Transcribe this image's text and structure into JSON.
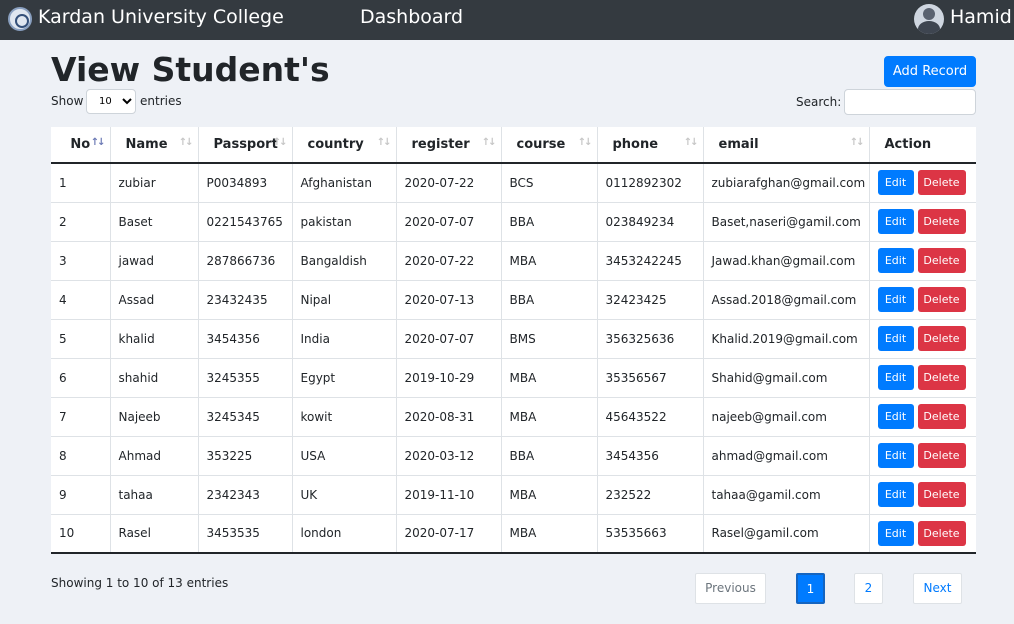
{
  "navbar": {
    "brand": "Kardan University College",
    "dashboard": "Dashboard",
    "user": "Hamid"
  },
  "page": {
    "title": "View Student's",
    "add_button": "Add Record"
  },
  "length": {
    "show": "Show",
    "value": "10",
    "entries": "entries"
  },
  "search": {
    "label": "Search:",
    "value": ""
  },
  "table": {
    "headers": [
      "No",
      "Name",
      "Passport",
      "country",
      "register",
      "course",
      "phone",
      "email",
      "Action"
    ],
    "rows": [
      [
        "1",
        "zubiar",
        "P0034893",
        "Afghanistan",
        "2020-07-22",
        "BCS",
        "0112892302",
        "zubiarafghan@gmail.com"
      ],
      [
        "2",
        "Baset",
        "0221543765",
        "pakistan",
        "2020-07-07",
        "BBA",
        "023849234",
        "Baset,naseri@gamil.com"
      ],
      [
        "3",
        "jawad",
        "287866736",
        "Bangaldish",
        "2020-07-22",
        "MBA",
        "3453242245",
        "Jawad.khan@gmail.com"
      ],
      [
        "4",
        "Assad",
        "23432435",
        "Nipal",
        "2020-07-13",
        "BBA",
        "32423425",
        "Assad.2018@gmail.com"
      ],
      [
        "5",
        "khalid",
        "3454356",
        "India",
        "2020-07-07",
        "BMS",
        "356325636",
        "Khalid.2019@gmail.com"
      ],
      [
        "6",
        "shahid",
        "3245355",
        "Egypt",
        "2019-10-29",
        "MBA",
        "35356567",
        "Shahid@gmail.com"
      ],
      [
        "7",
        "Najeeb",
        "3245345",
        "kowit",
        "2020-08-31",
        "MBA",
        "45643522",
        "najeeb@gmail.com"
      ],
      [
        "8",
        "Ahmad",
        "353225",
        "USA",
        "2020-03-12",
        "BBA",
        "3454356",
        "ahmad@gmail.com"
      ],
      [
        "9",
        "tahaa",
        "2342343",
        "UK",
        "2019-11-10",
        "MBA",
        "232522",
        "tahaa@gamil.com"
      ],
      [
        "10",
        "Rasel",
        "3453535",
        "london",
        "2020-07-17",
        "MBA",
        "53535663",
        "Rasel@gamil.com"
      ]
    ],
    "edit_label": "Edit",
    "delete_label": "Delete"
  },
  "footer": {
    "info": "Showing 1 to 10 of 13 entries",
    "previous": "Previous",
    "page1": "1",
    "page2": "2",
    "next": "Next"
  },
  "colors": {
    "navbar": "#343a40",
    "primary": "#007bff",
    "danger": "#dc3545",
    "background": "#eef1f6"
  }
}
